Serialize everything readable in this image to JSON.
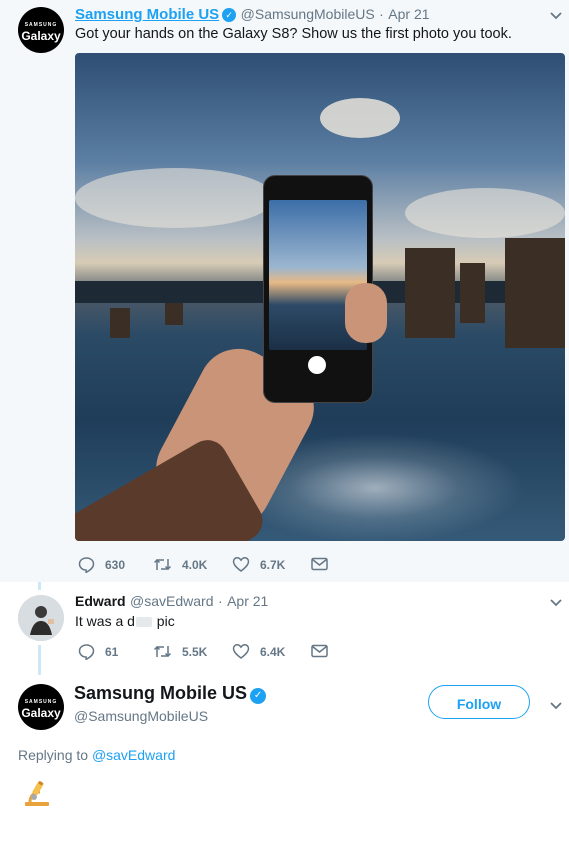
{
  "tweet1": {
    "author_name": "Samsung Mobile US",
    "author_handle": "@SamsungMobileUS",
    "date": "Apr 21",
    "text": "Got your hands on the Galaxy S8? Show us the first photo you took.",
    "avatar_top": "SAMSUNG",
    "avatar_bottom": "Galaxy",
    "stats": {
      "replies": "630",
      "retweets": "4.0K",
      "likes": "6.7K"
    }
  },
  "tweet2": {
    "author_name": "Edward",
    "author_handle": "@savEdward",
    "date": "Apr 21",
    "text_prefix": "It was a d",
    "text_suffix": " pic",
    "stats": {
      "replies": "61",
      "retweets": "5.5K",
      "likes": "6.4K"
    }
  },
  "reply": {
    "author_name": "Samsung Mobile US",
    "author_handle": "@SamsungMobileUS",
    "avatar_top": "SAMSUNG",
    "avatar_bottom": "Galaxy",
    "follow_label": "Follow",
    "replying_to_label": "Replying to",
    "replying_to_handle": "@savEdward",
    "emoji": "microscope-emoji"
  },
  "colors": {
    "link_blue": "#1da1f2",
    "muted": "#657786",
    "thread_line": "#cce7f5",
    "highlight_bg": "#f5f8fa"
  }
}
